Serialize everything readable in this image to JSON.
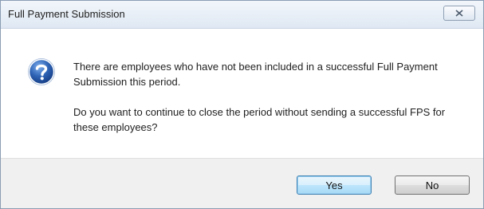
{
  "dialog": {
    "title": "Full Payment Submission",
    "icon": "question-icon",
    "message_1": "There are employees who have not been included in a successful Full Payment Submission this period.",
    "message_2": "Do you want to continue to close the period without sending a successful FPS for these employees?",
    "yes_label": "Yes",
    "no_label": "No",
    "close_icon": "close-icon"
  },
  "colors": {
    "accent": "#3c7fb1",
    "icon_blue": "#2e63b5"
  }
}
